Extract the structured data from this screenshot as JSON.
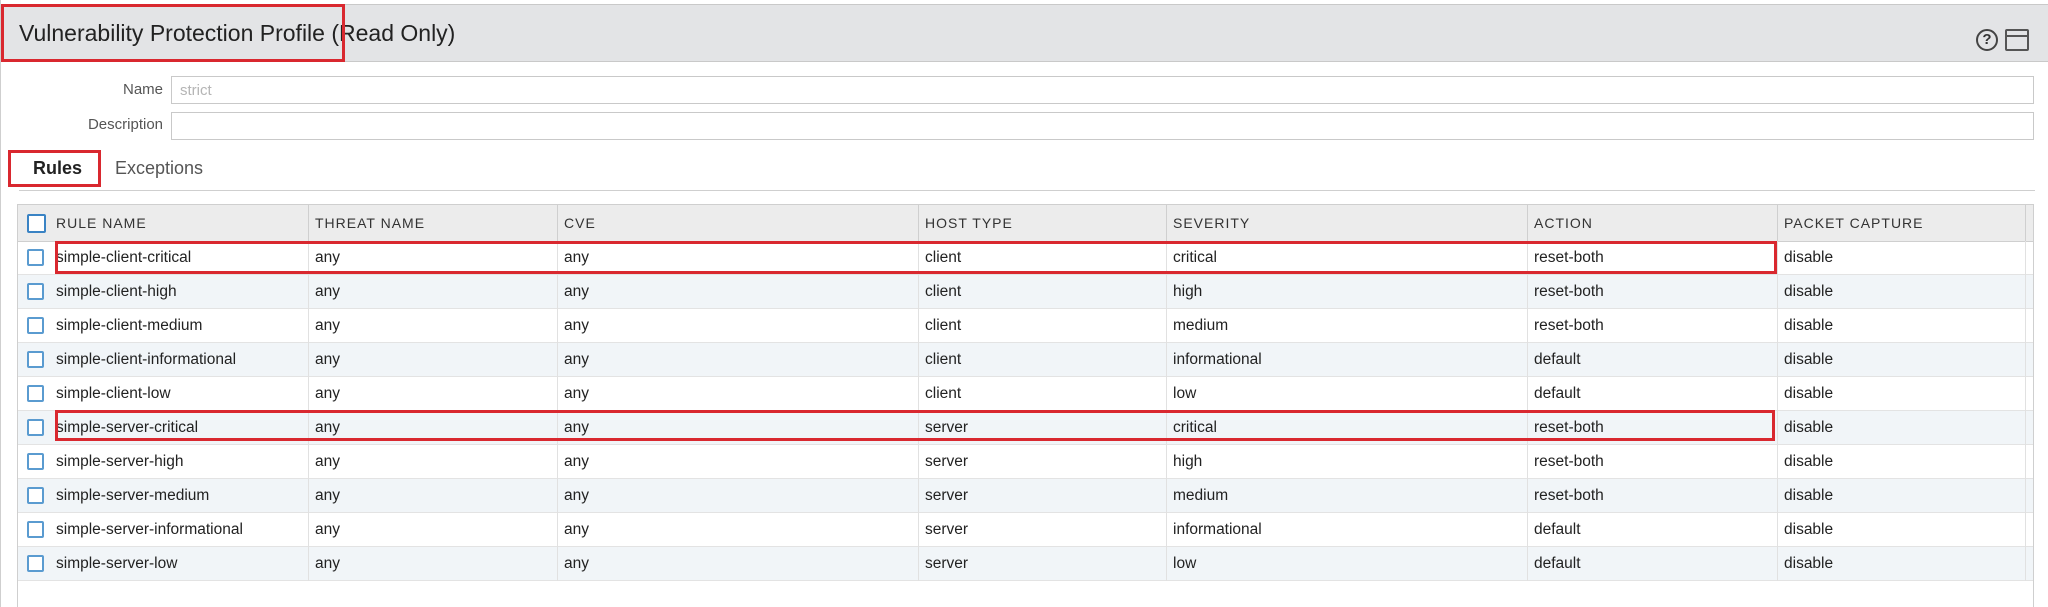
{
  "dialog": {
    "title": "Vulnerability Protection Profile (Read Only)"
  },
  "form": {
    "name_label": "Name",
    "name_value": "strict",
    "description_label": "Description",
    "description_value": ""
  },
  "tabs": [
    {
      "label": "Rules",
      "active": true
    },
    {
      "label": "Exceptions",
      "active": false
    }
  ],
  "table": {
    "columns": [
      "RULE NAME",
      "THREAT NAME",
      "CVE",
      "HOST TYPE",
      "SEVERITY",
      "ACTION",
      "PACKET CAPTURE"
    ],
    "rows": [
      {
        "rule_name": "simple-client-critical",
        "threat_name": "any",
        "cve": "any",
        "host_type": "client",
        "severity": "critical",
        "action": "reset-both",
        "packet_capture": "disable"
      },
      {
        "rule_name": "simple-client-high",
        "threat_name": "any",
        "cve": "any",
        "host_type": "client",
        "severity": "high",
        "action": "reset-both",
        "packet_capture": "disable"
      },
      {
        "rule_name": "simple-client-medium",
        "threat_name": "any",
        "cve": "any",
        "host_type": "client",
        "severity": "medium",
        "action": "reset-both",
        "packet_capture": "disable"
      },
      {
        "rule_name": "simple-client-informational",
        "threat_name": "any",
        "cve": "any",
        "host_type": "client",
        "severity": "informational",
        "action": "default",
        "packet_capture": "disable"
      },
      {
        "rule_name": "simple-client-low",
        "threat_name": "any",
        "cve": "any",
        "host_type": "client",
        "severity": "low",
        "action": "default",
        "packet_capture": "disable"
      },
      {
        "rule_name": "simple-server-critical",
        "threat_name": "any",
        "cve": "any",
        "host_type": "server",
        "severity": "critical",
        "action": "reset-both",
        "packet_capture": "disable"
      },
      {
        "rule_name": "simple-server-high",
        "threat_name": "any",
        "cve": "any",
        "host_type": "server",
        "severity": "high",
        "action": "reset-both",
        "packet_capture": "disable"
      },
      {
        "rule_name": "simple-server-medium",
        "threat_name": "any",
        "cve": "any",
        "host_type": "server",
        "severity": "medium",
        "action": "reset-both",
        "packet_capture": "disable"
      },
      {
        "rule_name": "simple-server-informational",
        "threat_name": "any",
        "cve": "any",
        "host_type": "server",
        "severity": "informational",
        "action": "default",
        "packet_capture": "disable"
      },
      {
        "rule_name": "simple-server-low",
        "threat_name": "any",
        "cve": "any",
        "host_type": "server",
        "severity": "low",
        "action": "default",
        "packet_capture": "disable"
      }
    ]
  },
  "icons": {
    "help": "help-icon",
    "window": "window-icon"
  },
  "colors": {
    "highlight": "#d9282f",
    "checkbox": "#3a83c4"
  }
}
